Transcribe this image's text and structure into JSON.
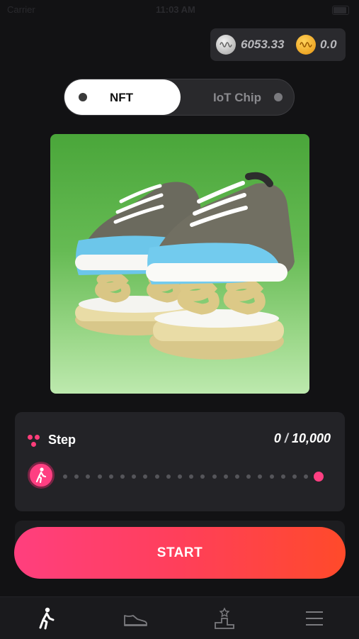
{
  "status_bar": {
    "carrier": "Carrier",
    "time": "11:03 AM"
  },
  "wallet": {
    "silver_balance": "6053.33",
    "gold_balance": "0.0",
    "silver_icon": "silver-coin-icon",
    "gold_icon": "gold-coin-icon"
  },
  "toggle": {
    "selected": "NFT",
    "left_label": "NFT",
    "right_label": "IoT Chip"
  },
  "nft_image": {
    "subject": "sneakers-on-springs"
  },
  "step": {
    "label": "Step",
    "current": "0",
    "separator": "/",
    "goal": "10,000",
    "progress": 0
  },
  "start_button": {
    "label": "START"
  },
  "tabbar": {
    "items": [
      {
        "icon": "walk-icon",
        "active": true
      },
      {
        "icon": "sneaker-icon",
        "active": false
      },
      {
        "icon": "leaderboard-icon",
        "active": false
      },
      {
        "icon": "menu-icon",
        "active": false
      }
    ]
  },
  "colors": {
    "accent_pink": "#ff3f82",
    "accent_orange": "#ff4a2a",
    "background": "#121214",
    "card_green": "#4aa63a"
  }
}
